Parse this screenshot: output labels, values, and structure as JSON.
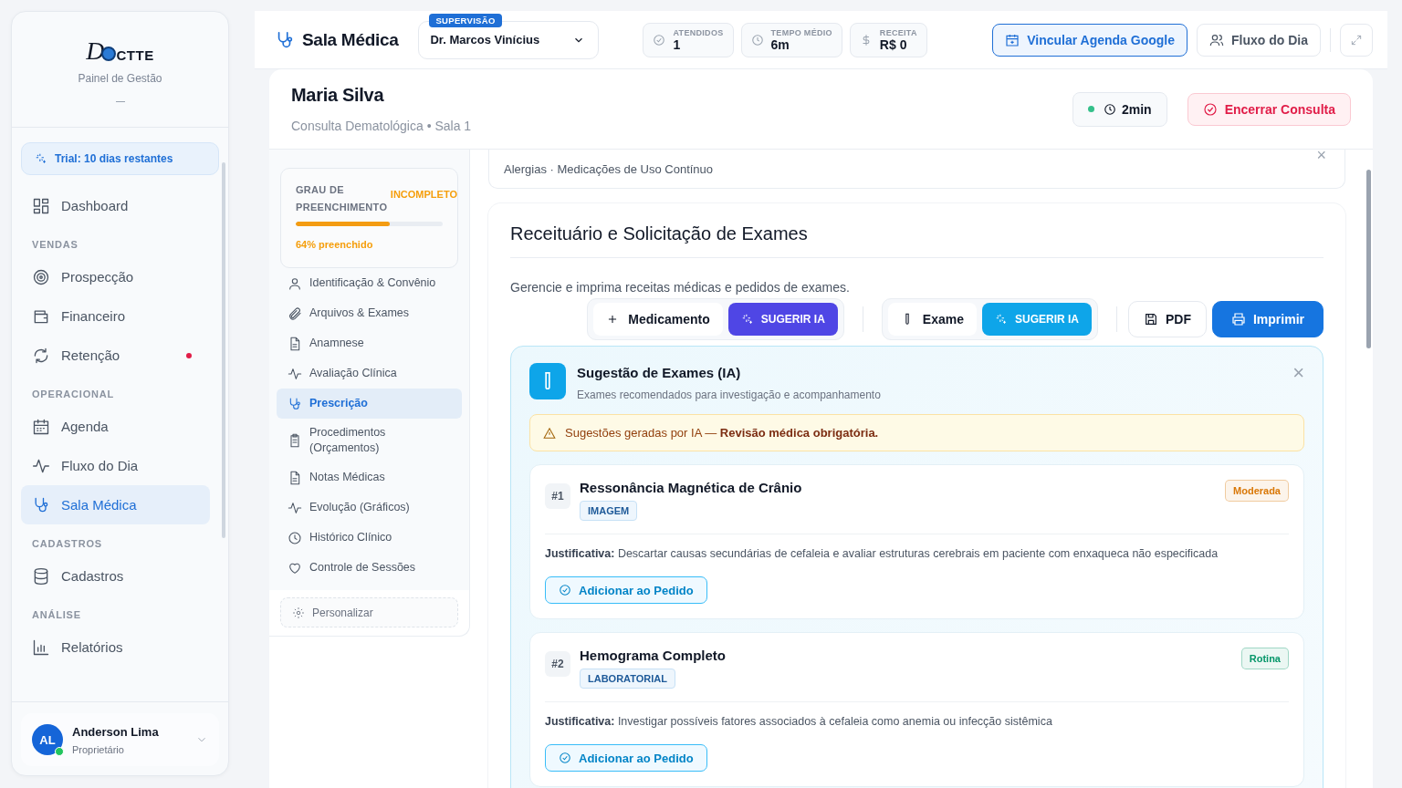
{
  "sidebar": {
    "logo": {
      "lead": "D",
      "tail": "CTTE"
    },
    "subtitle": "Painel de Gestão",
    "trial": "Trial: 10 dias restantes",
    "sections": [
      {
        "items": [
          {
            "label": "Dashboard",
            "selected": false,
            "alert": false
          }
        ]
      },
      {
        "heading": "VENDAS",
        "items": [
          {
            "label": "Prospecção",
            "selected": false,
            "alert": false
          },
          {
            "label": "Financeiro",
            "selected": false,
            "alert": false
          },
          {
            "label": "Retenção",
            "selected": false,
            "alert": true
          }
        ]
      },
      {
        "heading": "OPERACIONAL",
        "items": [
          {
            "label": "Agenda",
            "selected": false,
            "alert": false
          },
          {
            "label": "Fluxo do Dia",
            "selected": false,
            "alert": false
          },
          {
            "label": "Sala Médica",
            "selected": true,
            "alert": false
          }
        ]
      },
      {
        "heading": "CADASTROS",
        "items": [
          {
            "label": "Cadastros",
            "selected": false,
            "alert": false
          }
        ]
      },
      {
        "heading": "ANÁLISE",
        "items": [
          {
            "label": "Relatórios",
            "selected": false,
            "alert": false
          }
        ]
      }
    ],
    "user": {
      "initials": "AL",
      "name": "Anderson Lima",
      "role": "Proprietário",
      "online": true
    }
  },
  "topbar": {
    "title": "Sala Médica",
    "doctor": {
      "badge": "SUPERVISÃO",
      "value": "Dr. Marcos Vinícius"
    },
    "stats": [
      {
        "label": "ATENDIDOS",
        "value": "1"
      },
      {
        "label": "TEMPO MÉDIO",
        "value": "6m"
      },
      {
        "label": "RECEITA",
        "value": "R$ 0"
      }
    ],
    "buttons": [
      {
        "label": "Vincular Agenda Google",
        "kind": "primary"
      },
      {
        "label": "Fluxo do Dia",
        "kind": "plain"
      }
    ]
  },
  "patient": {
    "name": "Maria Silva",
    "subtitle": "Consulta Dematológica • Sala 1",
    "timer": "2min",
    "live": true,
    "end_button": "Encerrar Consulta"
  },
  "progress": {
    "label": "GRAU DE PREENCHIMENTO",
    "status": "INCOMPLETO",
    "level": 0.64,
    "caption": "64% preenchido"
  },
  "subnav": [
    {
      "label": "Identificação & Convênio",
      "selected": false
    },
    {
      "label": "Arquivos & Exames",
      "selected": false
    },
    {
      "label": "Anamnese",
      "selected": false
    },
    {
      "label": "Avaliação Clínica",
      "selected": false
    },
    {
      "label": "Prescrição",
      "selected": true
    },
    {
      "label": "Procedimentos (Orçamentos)",
      "selected": false
    },
    {
      "label": "Notas Médicas",
      "selected": false
    },
    {
      "label": "Evolução (Gráficos)",
      "selected": false
    },
    {
      "label": "Histórico Clínico",
      "selected": false
    },
    {
      "label": "Controle de Sessões",
      "selected": false
    }
  ],
  "customize": "Personalizar",
  "allergy_bar": {
    "text": "Alergias · Medicações de Uso Contínuo",
    "close": "×"
  },
  "prescription": {
    "title": "Receituário e Solicitação de Exames",
    "description": "Gerencie e imprima receitas médicas e pedidos de exames.",
    "groups": [
      {
        "label": "Medicamento",
        "ai": "SUGERIR IA",
        "color": "#4f46e5"
      },
      {
        "label": "Exame",
        "ai": "SUGERIR IA",
        "color": "#0ea5e9"
      }
    ],
    "actions": [
      {
        "label": "PDF",
        "kind": "plain"
      },
      {
        "label": "Imprimir",
        "kind": "primary"
      }
    ]
  },
  "suggestions": {
    "title": "Sugestão de Exames (IA)",
    "subtitle": "Exames recomendados para investigação e acompanhamento",
    "close": "×",
    "warning": "Sugestões geradas por IA — **Revisão médica obrigatória.**",
    "exams": [
      {
        "number": "#1",
        "name": "Ressonância Magnética de Crânio",
        "category": "IMAGEM",
        "priority": "Moderada",
        "color": "#d97706",
        "justification": "**Justificativa:** Descartar causas secundárias de cefaleia e avaliar estruturas cerebrais em paciente com enxaqueca não especificada",
        "action": "Adicionar ao Pedido"
      },
      {
        "number": "#2",
        "name": "Hemograma Completo",
        "category": "LABORATORIAL",
        "priority": "Rotina",
        "color": "#059669",
        "justification": "**Justificativa:** Investigar possíveis fatores associados à cefaleia como anemia ou infecção sistêmica",
        "action": "Adicionar ao Pedido"
      }
    ]
  }
}
